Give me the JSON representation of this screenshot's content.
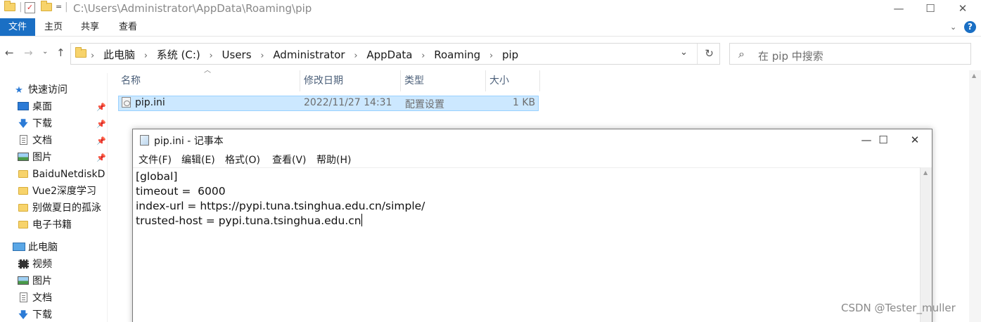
{
  "window": {
    "title_path": "C:\\Users\\Administrator\\AppData\\Roaming\\pip",
    "quick_access_more": "="
  },
  "ribbon": {
    "tabs": [
      {
        "label": "文件"
      },
      {
        "label": "主页"
      },
      {
        "label": "共享"
      },
      {
        "label": "查看"
      }
    ],
    "help": "?"
  },
  "address": {
    "breadcrumb": [
      "此电脑",
      "系统 (C:)",
      "Users",
      "Administrator",
      "AppData",
      "Roaming",
      "pip"
    ],
    "search_placeholder": "在 pip 中搜索"
  },
  "navpane": {
    "quick_access": "快速访问",
    "items": [
      {
        "label": "桌面",
        "icon": "desktop-icon",
        "pinned": true
      },
      {
        "label": "下载",
        "icon": "download-icon",
        "pinned": true
      },
      {
        "label": "文档",
        "icon": "document-icon",
        "pinned": true
      },
      {
        "label": "图片",
        "icon": "picture-icon",
        "pinned": true
      },
      {
        "label": "BaiduNetdiskD",
        "icon": "folder-icon",
        "pinned": false
      },
      {
        "label": "Vue2深度学习",
        "icon": "folder-icon",
        "pinned": false
      },
      {
        "label": "别做夏日的孤泳",
        "icon": "folder-icon",
        "pinned": false
      },
      {
        "label": "电子书籍",
        "icon": "folder-icon",
        "pinned": false
      }
    ],
    "this_pc": "此电脑",
    "pc_items": [
      {
        "label": "视频",
        "icon": "video-icon"
      },
      {
        "label": "图片",
        "icon": "picture-icon"
      },
      {
        "label": "文档",
        "icon": "document-icon"
      },
      {
        "label": "下载",
        "icon": "download-icon"
      }
    ]
  },
  "filelist": {
    "columns": [
      "名称",
      "修改日期",
      "类型",
      "大小"
    ],
    "rows": [
      {
        "name": "pip.ini",
        "modified": "2022/11/27 14:31",
        "type": "配置设置",
        "size": "1 KB"
      }
    ]
  },
  "notepad": {
    "title": "pip.ini - 记事本",
    "menu": [
      "文件(F)",
      "编辑(E)",
      "格式(O)",
      "查看(V)",
      "帮助(H)"
    ],
    "lines": [
      "[global]",
      "timeout =  6000",
      "index-url = https://pypi.tuna.tsinghua.edu.cn/simple/",
      "trusted-host = pypi.tuna.tsinghua.edu.cn"
    ]
  },
  "watermark": "CSDN @Tester_muller",
  "colors": {
    "accent": "#1a6fc4",
    "selection": "#cce8ff",
    "selection_border": "#99d1ff"
  }
}
